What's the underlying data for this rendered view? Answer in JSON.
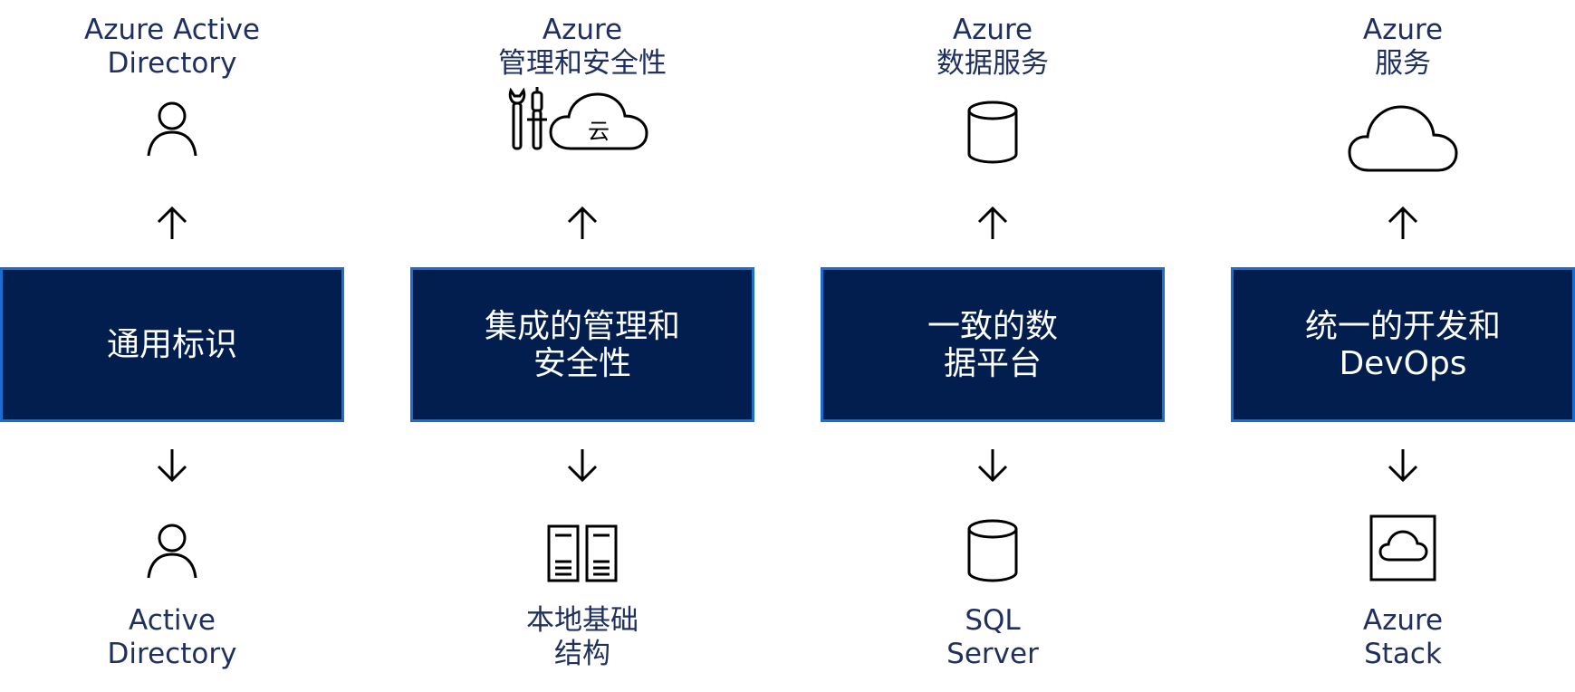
{
  "columns": [
    {
      "top_label": [
        "Azure Active",
        "Directory"
      ],
      "top_icon": "user-icon",
      "box": [
        "通用标识"
      ],
      "bottom_icon": "user-icon",
      "bottom_label": [
        "Active",
        "Directory"
      ]
    },
    {
      "top_label": [
        "Azure",
        "管理和安全性"
      ],
      "top_icon": "tools-cloud-icon",
      "cloud_text": "云",
      "box": [
        "集成的管理和",
        "安全性"
      ],
      "bottom_icon": "server-icon",
      "bottom_label": [
        "本地基础",
        "结构"
      ]
    },
    {
      "top_label": [
        "Azure",
        "数据服务"
      ],
      "top_icon": "database-icon",
      "box": [
        "一致的数",
        "据平台"
      ],
      "bottom_icon": "database-icon",
      "bottom_label": [
        "SQL",
        "Server"
      ]
    },
    {
      "top_label": [
        "Azure",
        "服务"
      ],
      "top_icon": "cloud-icon",
      "box": [
        "统一的开发和",
        "DevOps"
      ],
      "bottom_icon": "cloud-box-icon",
      "bottom_label": [
        "Azure",
        "Stack"
      ]
    }
  ],
  "colors": {
    "box_fill": "#021e4f",
    "box_border": "#1a6ed0",
    "label_text": "#1f3060",
    "icon_stroke": "#000000"
  }
}
